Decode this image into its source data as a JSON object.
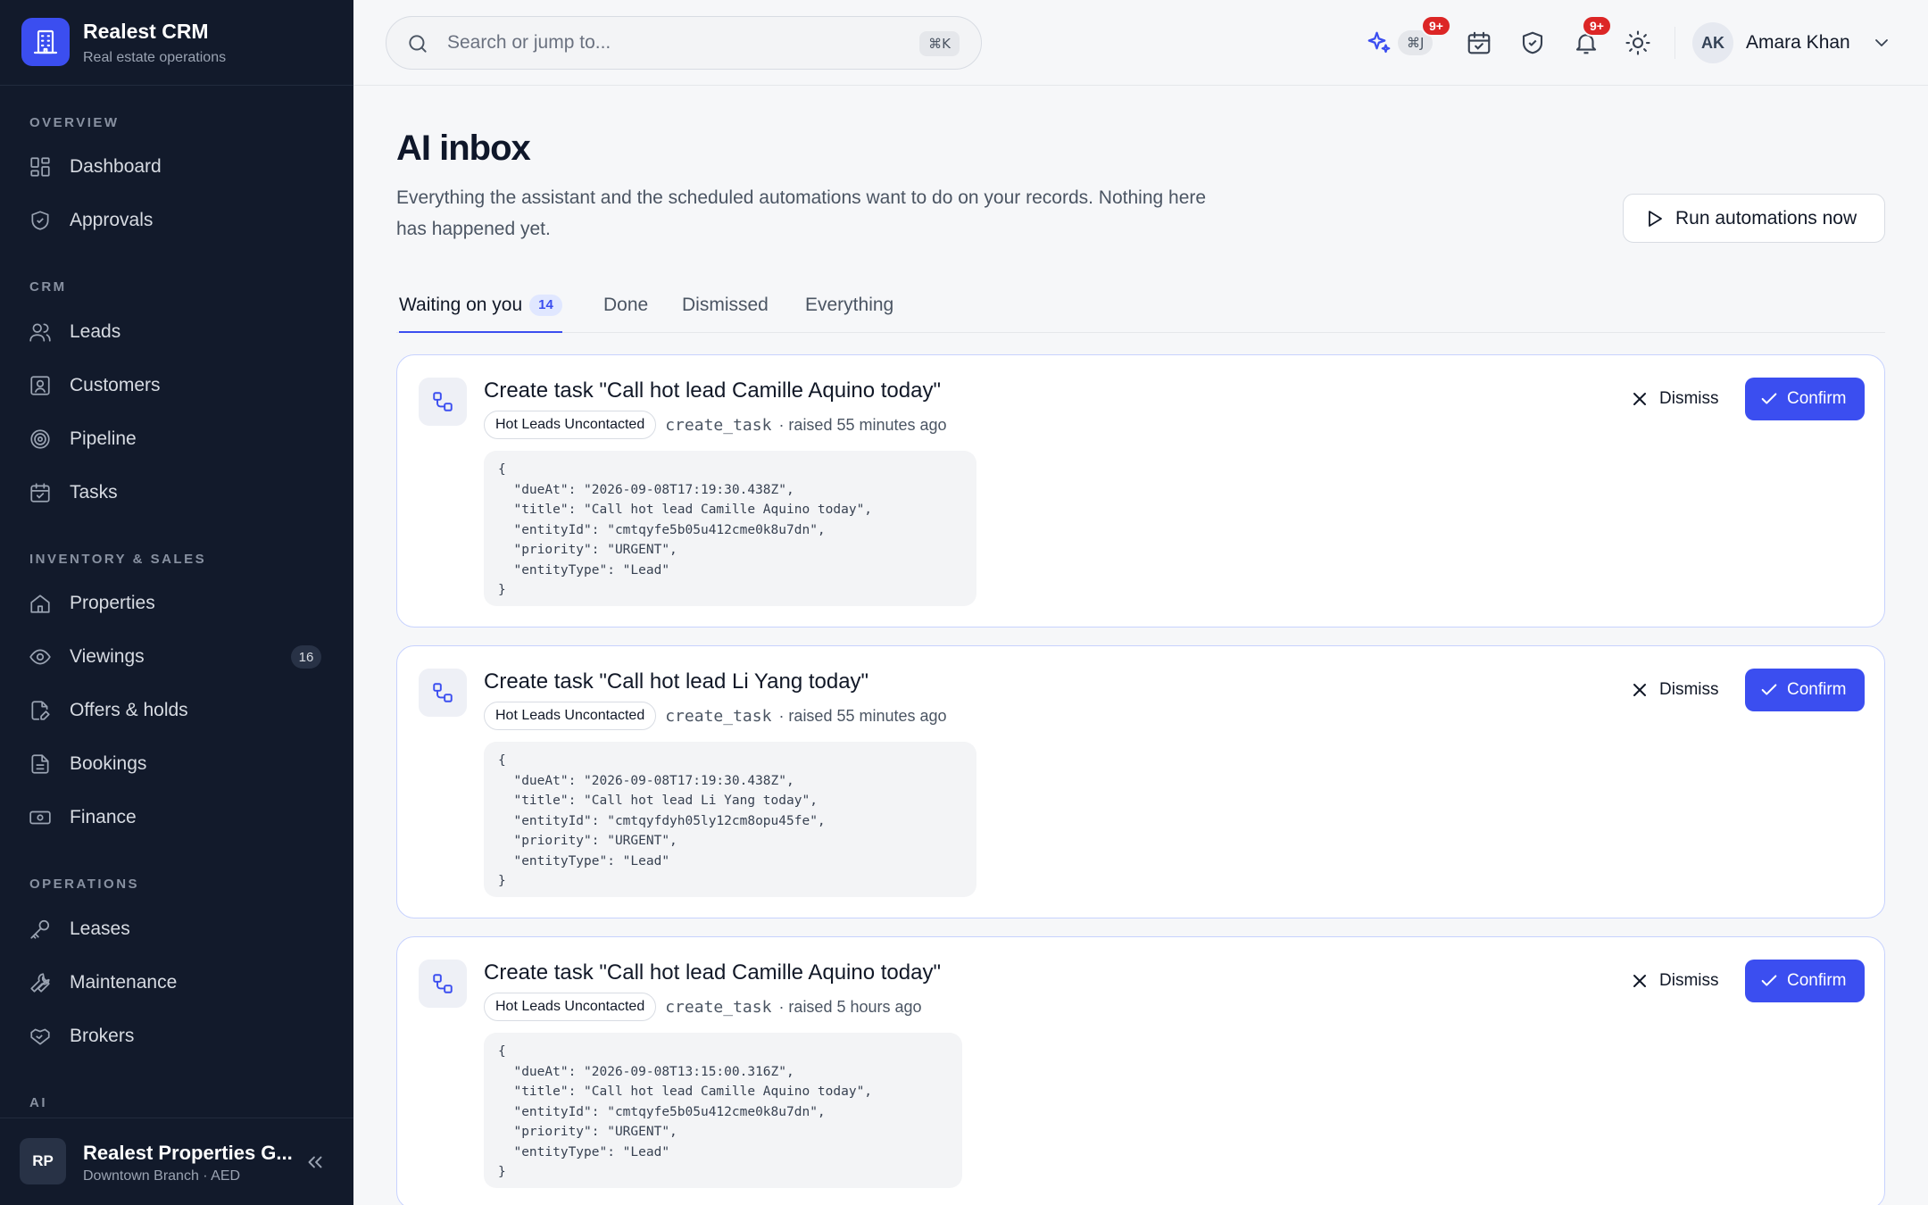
{
  "brand": {
    "name": "Realest CRM",
    "subtitle": "Real estate operations"
  },
  "sidebar": {
    "sections": [
      "OVERVIEW",
      "CRM",
      "INVENTORY & SALES",
      "OPERATIONS",
      "AI"
    ],
    "items": [
      {
        "label": "Dashboard",
        "icon": "grid-icon"
      },
      {
        "label": "Approvals",
        "icon": "shield-check-icon"
      },
      {
        "label": "Leads",
        "icon": "users-icon"
      },
      {
        "label": "Customers",
        "icon": "contact-icon"
      },
      {
        "label": "Pipeline",
        "icon": "target-icon"
      },
      {
        "label": "Tasks",
        "icon": "calendar-check-icon"
      },
      {
        "label": "Properties",
        "icon": "home-icon"
      },
      {
        "label": "Viewings",
        "icon": "eye-icon",
        "badge": "16"
      },
      {
        "label": "Offers & holds",
        "icon": "file-edit-icon"
      },
      {
        "label": "Bookings",
        "icon": "document-icon"
      },
      {
        "label": "Finance",
        "icon": "banknote-icon"
      },
      {
        "label": "Leases",
        "icon": "key-icon"
      },
      {
        "label": "Maintenance",
        "icon": "wrench-icon"
      },
      {
        "label": "Brokers",
        "icon": "handshake-icon"
      }
    ]
  },
  "org": {
    "initials": "RP",
    "name": "Realest Properties G...",
    "subtitle": "Downtown Branch · AED"
  },
  "topbar": {
    "search_placeholder": "Search or jump to...",
    "search_shortcut": "⌘K",
    "assistant_shortcut": "⌘J",
    "assistant_badge": "9+",
    "notifications_badge": "9+",
    "user_initials": "AK",
    "user_name": "Amara Khan"
  },
  "page": {
    "title": "AI inbox",
    "description": "Everything the assistant and the scheduled automations want to do on your records. Nothing here has happened yet.",
    "run_button": "Run automations now"
  },
  "tabs": [
    {
      "label": "Waiting on you",
      "count": "14"
    },
    {
      "label": "Done"
    },
    {
      "label": "Dismissed"
    },
    {
      "label": "Everything"
    }
  ],
  "actions": {
    "dismiss": "Dismiss",
    "confirm": "Confirm"
  },
  "colors": {
    "accent": "#3b4ef0",
    "sidebar_bg": "#121a2b",
    "badge_red": "#dc2626"
  },
  "cards": [
    {
      "title": "Create task \"Call hot lead Camille Aquino today\"",
      "chip": "Hot Leads Uncontacted",
      "op": "create_task",
      "raised": "· raised 55 minutes ago",
      "payload": "{\n  \"dueAt\": \"2026-09-08T17:19:30.438Z\",\n  \"title\": \"Call hot lead Camille Aquino today\",\n  \"entityId\": \"cmtqyfe5b05u412cme0k8u7dn\",\n  \"priority\": \"URGENT\",\n  \"entityType\": \"Lead\"\n}"
    },
    {
      "title": "Create task \"Call hot lead Li Yang today\"",
      "chip": "Hot Leads Uncontacted",
      "op": "create_task",
      "raised": "· raised 55 minutes ago",
      "payload": "{\n  \"dueAt\": \"2026-09-08T17:19:30.438Z\",\n  \"title\": \"Call hot lead Li Yang today\",\n  \"entityId\": \"cmtqyfdyh05ly12cm8opu45fe\",\n  \"priority\": \"URGENT\",\n  \"entityType\": \"Lead\"\n}"
    },
    {
      "title": "Create task \"Call hot lead Camille Aquino today\"",
      "chip": "Hot Leads Uncontacted",
      "op": "create_task",
      "raised": "· raised 5 hours ago",
      "payload": "{\n  \"dueAt\": \"2026-09-08T13:15:00.316Z\",\n  \"title\": \"Call hot lead Camille Aquino today\",\n  \"entityId\": \"cmtqyfe5b05u412cme0k8u7dn\",\n  \"priority\": \"URGENT\",\n  \"entityType\": \"Lead\"\n}"
    }
  ]
}
